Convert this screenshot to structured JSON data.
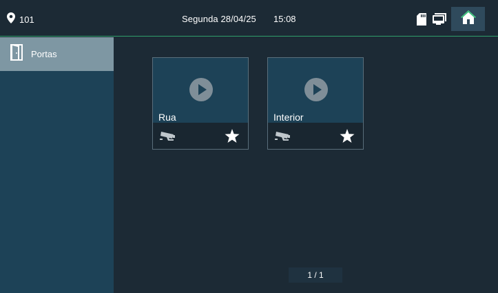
{
  "statusbar": {
    "location": "101",
    "date": "Segunda 28/04/25",
    "time": "15:08",
    "icons": [
      "location-pin-icon",
      "sd-card-icon",
      "monitor-icon",
      "home-icon"
    ],
    "accent_color": "#2fa06a"
  },
  "sidebar": {
    "items": [
      {
        "label": "Portas",
        "icon": "door-icon",
        "selected": true
      }
    ]
  },
  "main": {
    "cards": [
      {
        "name": "Rua",
        "icons": [
          "play-icon",
          "cctv-camera-icon",
          "star-icon"
        ]
      },
      {
        "name": "Interior",
        "icons": [
          "play-icon",
          "cctv-camera-icon",
          "star-icon"
        ]
      }
    ],
    "pager": "1 / 1"
  }
}
